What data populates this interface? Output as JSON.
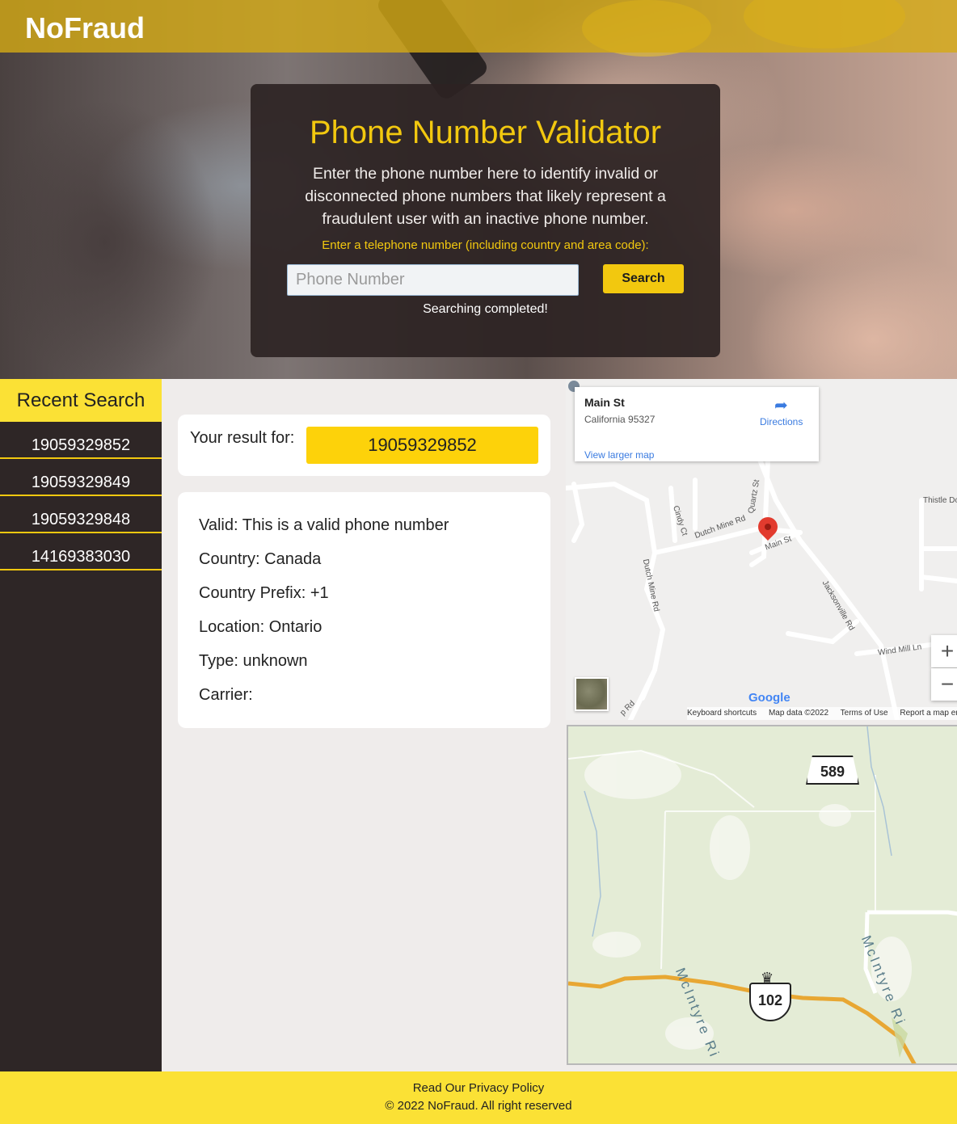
{
  "header": {
    "logo": "NoFraud"
  },
  "validator": {
    "title": "Phone Number Validator",
    "description": "Enter the phone number here to identify invalid or disconnected phone numbers that likely represent a fraudulent user with an inactive phone number.",
    "hint": "Enter a telephone number (including country and area code):",
    "input_placeholder": "Phone Number",
    "input_value": "",
    "search_label": "Search",
    "status": "Searching completed!"
  },
  "sidebar": {
    "title": "Recent Search",
    "items": [
      "19059329852",
      "19059329849",
      "19059329848",
      "14169383030"
    ]
  },
  "result": {
    "label": "Your result for:",
    "number": "19059329852",
    "details": [
      "Valid: This is a valid phone number",
      "Country: Canada",
      "Country Prefix: +1",
      "Location: Ontario",
      "Type: unknown",
      "Carrier:"
    ]
  },
  "google_map": {
    "place_title": "Main St",
    "place_address": "California 95327",
    "directions_label": "Directions",
    "view_larger": "View larger map",
    "zoom_in": "+",
    "zoom_out": "−",
    "logo": "Google",
    "footer": [
      "Keyboard shortcuts",
      "Map data ©2022",
      "Terms of Use",
      "Report a map er"
    ],
    "streets": [
      "Thistle Do",
      "Cindy Ct",
      "Dutch Mine Rd",
      "Quartz St",
      "Main St",
      "Dutch Mine Rd",
      "Jacksonville Rd",
      "Wind Mill Ln",
      "p Rd"
    ]
  },
  "bing_map": {
    "shield_top": "589",
    "shield_bottom": "102",
    "river_labels": [
      "McIntyre Ri",
      "McIntyre Ri"
    ]
  },
  "footer": {
    "privacy": "Read Our Privacy Policy",
    "copyright": "© 2022 NoFraud. All right reserved"
  },
  "colors": {
    "accent": "#f2c80f",
    "footer": "#fbe135",
    "sidebar": "#2e2626"
  }
}
